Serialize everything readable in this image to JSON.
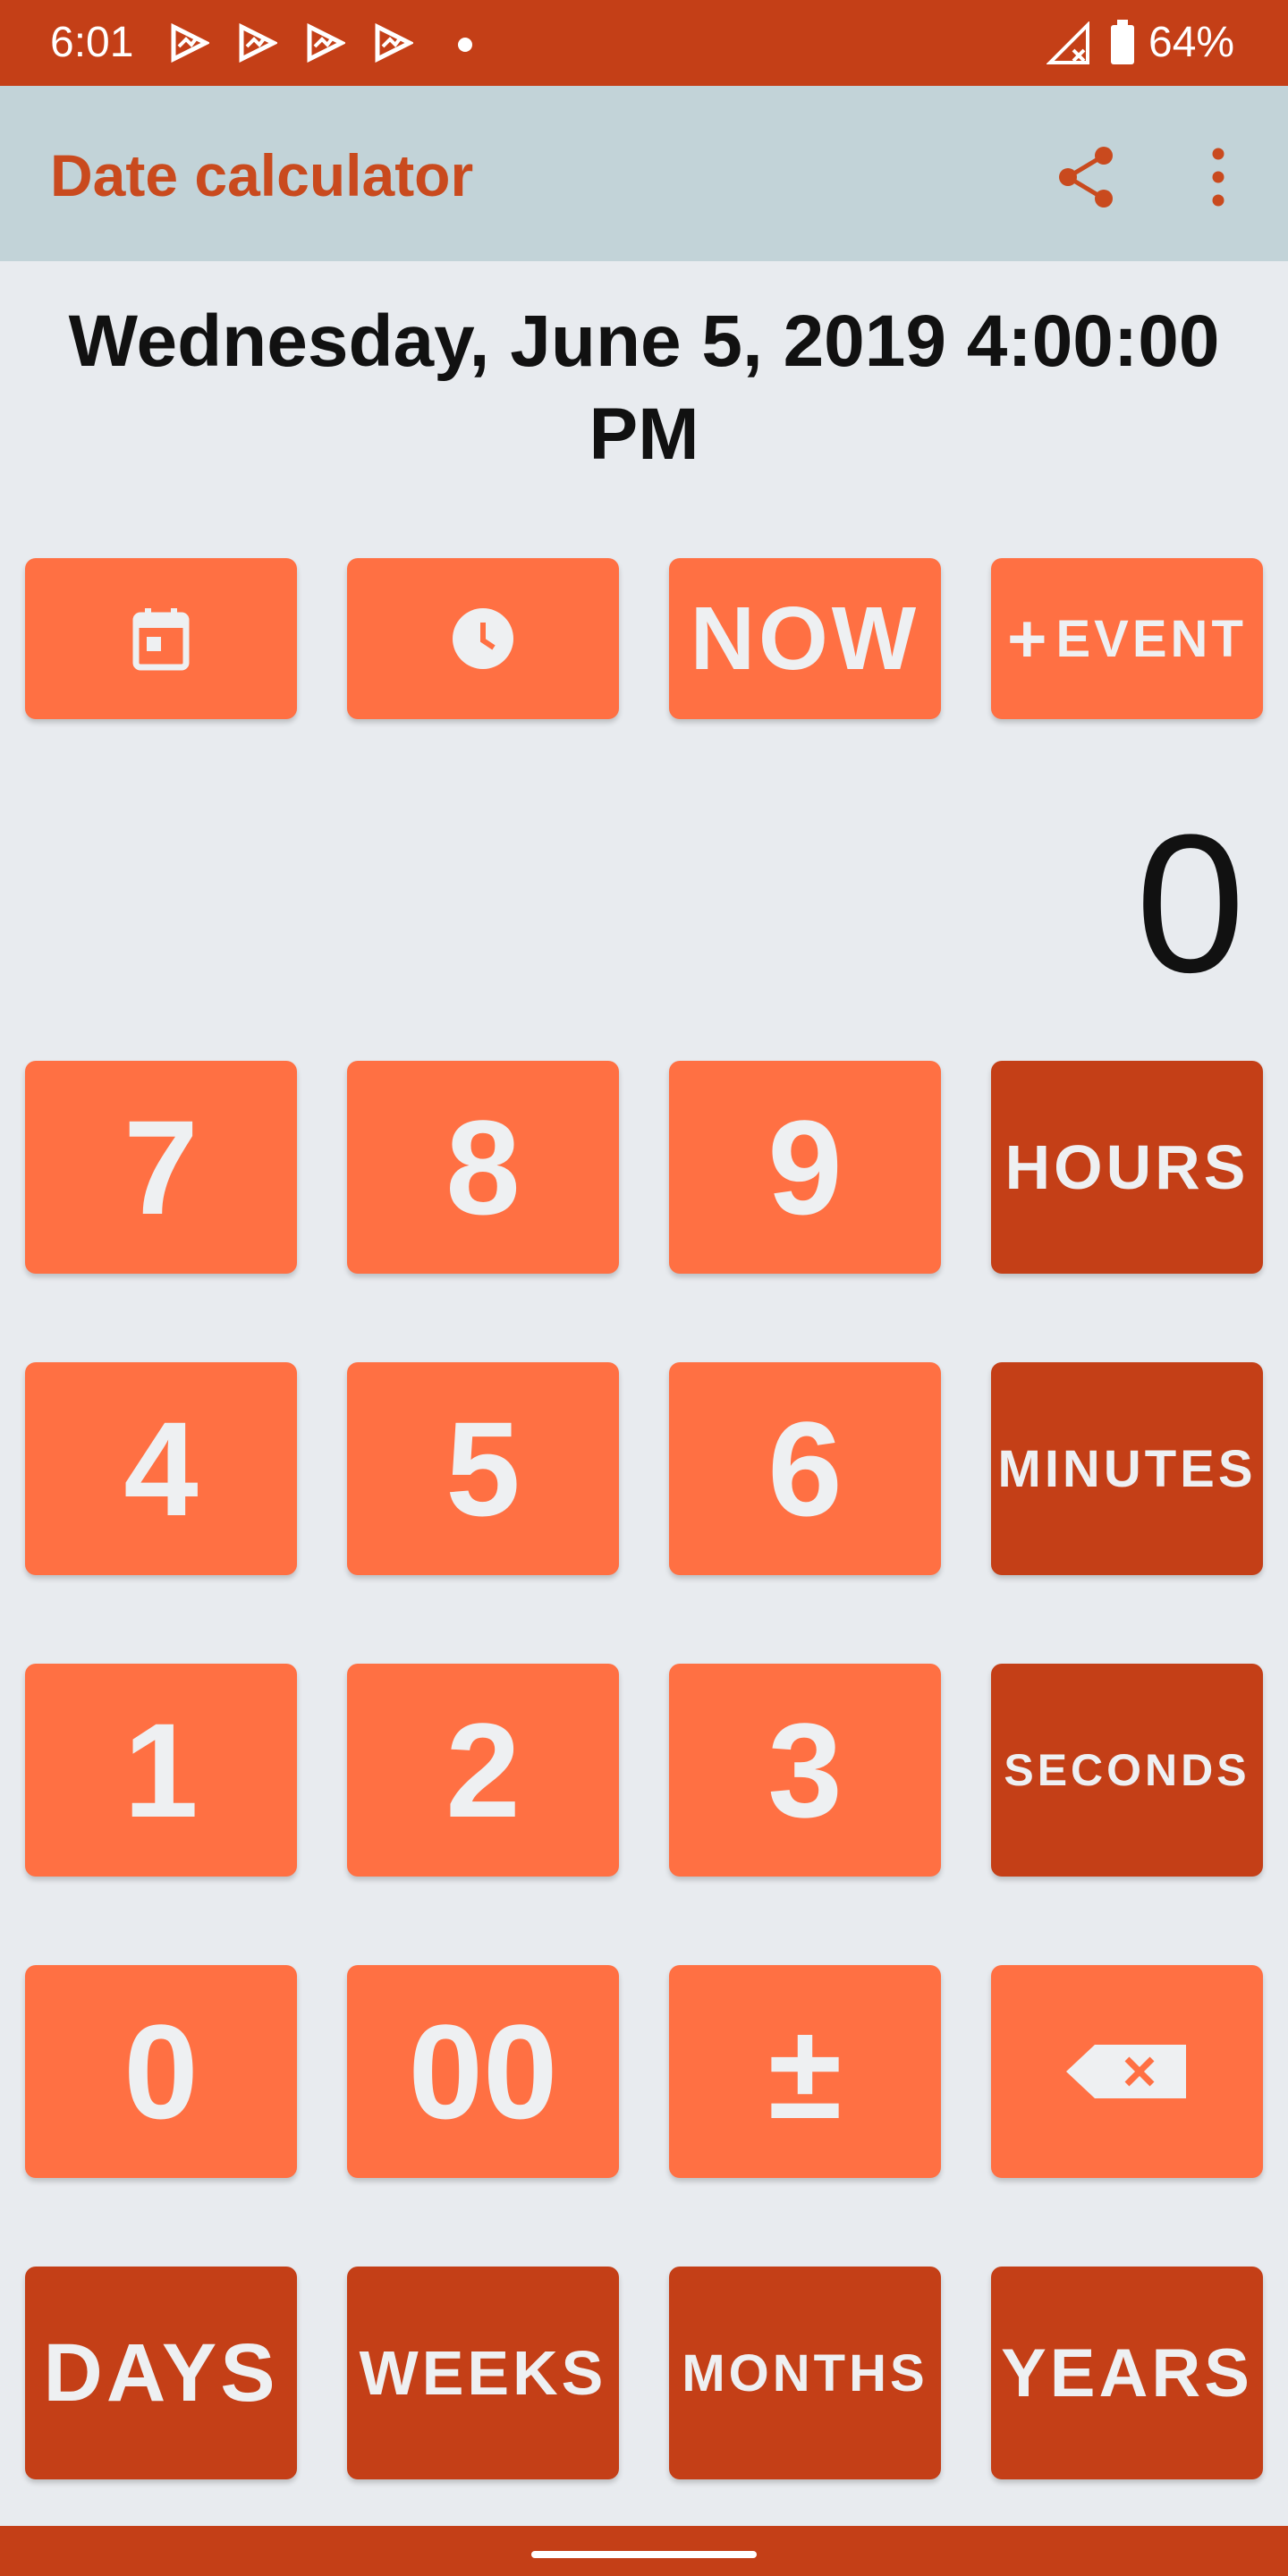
{
  "status_bar": {
    "time": "6:01",
    "battery": "64%"
  },
  "app_bar": {
    "title": "Date calculator"
  },
  "datetime_display": "Wednesday, June 5, 2019 4:00:00 PM",
  "quick_buttons": {
    "now": "NOW",
    "event": "EVENT"
  },
  "value_display": "0",
  "keypad": {
    "rows": [
      [
        "7",
        "8",
        "9"
      ],
      [
        "4",
        "5",
        "6"
      ],
      [
        "1",
        "2",
        "3"
      ],
      [
        "0",
        "00",
        "±"
      ]
    ],
    "hours": "HOURS",
    "minutes": "MINUTES",
    "seconds": "SECONDS"
  },
  "units": {
    "days": "DAYS",
    "weeks": "WEEKS",
    "months": "MONTHS",
    "years": "YEARS"
  },
  "colors": {
    "primary_dark": "#C43F17",
    "primary_light": "#FF7043",
    "app_bar": "#C2D3D8",
    "background": "#E8EBEF"
  }
}
